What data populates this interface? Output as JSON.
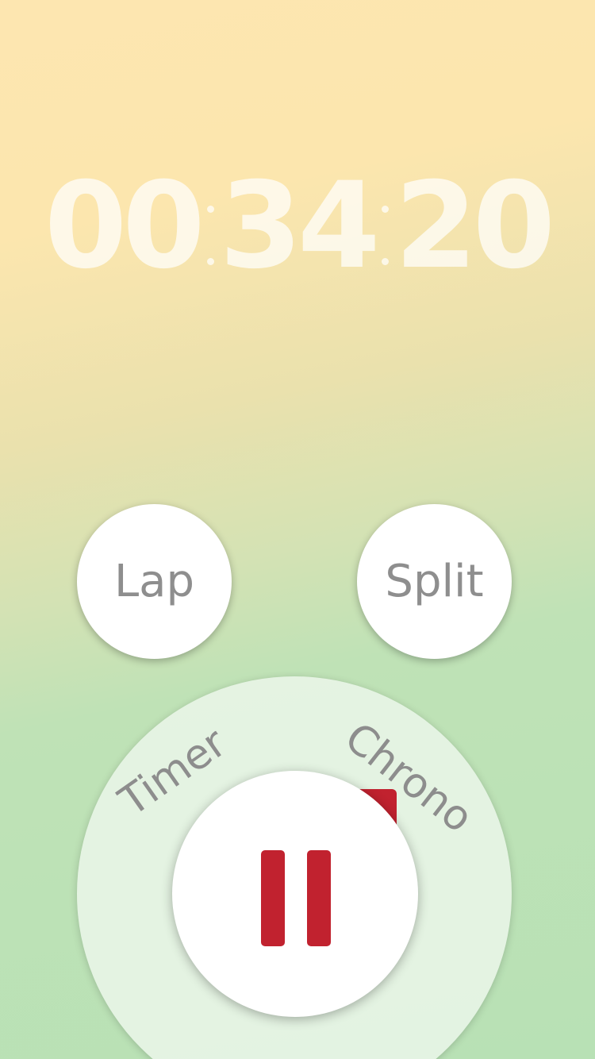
{
  "timer": {
    "hours": "00",
    "minutes": "34",
    "seconds": "20"
  },
  "actions": {
    "lap_label": "Lap",
    "split_label": "Split"
  },
  "mode_dial": {
    "options": [
      {
        "label": "Timer",
        "selected": false
      },
      {
        "label": "Chrono",
        "selected": true
      }
    ]
  },
  "main_control": {
    "icon": "pause-icon",
    "state": "running"
  },
  "colors": {
    "accent": "#c1222f",
    "background_top": "#fde6b0",
    "background_bottom": "#b8e1b5",
    "label_text": "#8e8e8e"
  }
}
